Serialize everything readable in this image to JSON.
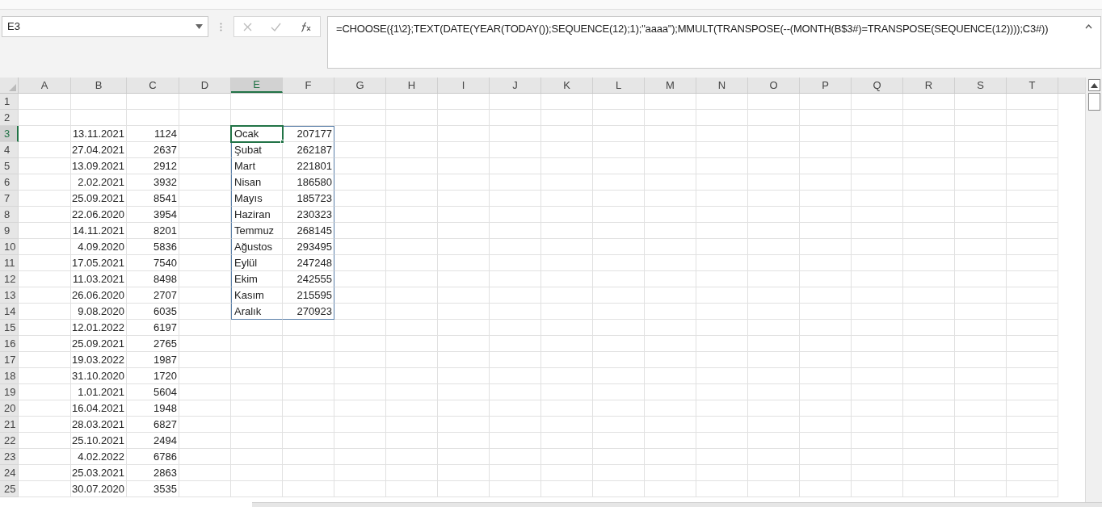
{
  "name_box": "E3",
  "formula": "=CHOOSE({1\\2};TEXT(DATE(YEAR(TODAY());SEQUENCE(12);1);\"aaaa\");MMULT(TRANSPOSE(--(MONTH(B$3#)=TRANSPOSE(SEQUENCE(12))));C3#))",
  "columns": [
    {
      "label": "A",
      "selected": false
    },
    {
      "label": "B",
      "selected": false
    },
    {
      "label": "C",
      "selected": false
    },
    {
      "label": "D",
      "selected": false
    },
    {
      "label": "E",
      "selected": true
    },
    {
      "label": "F",
      "selected": false
    },
    {
      "label": "G",
      "selected": false
    },
    {
      "label": "H",
      "selected": false
    },
    {
      "label": "I",
      "selected": false
    },
    {
      "label": "J",
      "selected": false
    },
    {
      "label": "K",
      "selected": false
    },
    {
      "label": "L",
      "selected": false
    },
    {
      "label": "M",
      "selected": false
    },
    {
      "label": "N",
      "selected": false
    },
    {
      "label": "O",
      "selected": false
    },
    {
      "label": "P",
      "selected": false
    },
    {
      "label": "Q",
      "selected": false
    },
    {
      "label": "R",
      "selected": false
    },
    {
      "label": "S",
      "selected": false
    },
    {
      "label": "T",
      "selected": false
    }
  ],
  "rows": [
    {
      "number": "1",
      "selected": false
    },
    {
      "number": "2",
      "selected": false
    },
    {
      "number": "3",
      "selected": true,
      "b": {
        "text": "13.11.2021",
        "selected": false
      },
      "c": {
        "text": "1124",
        "selected": false
      },
      "e": {
        "text": "Ocak",
        "selected": true,
        "spill": true
      },
      "f": {
        "text": "207177",
        "selected": false,
        "spill": true
      }
    },
    {
      "number": "4",
      "selected": false,
      "b": {
        "text": "27.04.2021",
        "selected": false
      },
      "c": {
        "text": "2637",
        "selected": false
      },
      "e": {
        "text": "Şubat",
        "selected": false,
        "spill": true
      },
      "f": {
        "text": "262187",
        "selected": false,
        "spill": true
      }
    },
    {
      "number": "5",
      "selected": false,
      "b": {
        "text": "13.09.2021",
        "selected": false
      },
      "c": {
        "text": "2912",
        "selected": false
      },
      "e": {
        "text": "Mart",
        "selected": false,
        "spill": true
      },
      "f": {
        "text": "221801",
        "selected": false,
        "spill": true
      }
    },
    {
      "number": "6",
      "selected": false,
      "b": {
        "text": "2.02.2021",
        "selected": false
      },
      "c": {
        "text": "3932",
        "selected": false
      },
      "e": {
        "text": "Nisan",
        "selected": false,
        "spill": true
      },
      "f": {
        "text": "186580",
        "selected": false,
        "spill": true
      }
    },
    {
      "number": "7",
      "selected": false,
      "b": {
        "text": "25.09.2021",
        "selected": false
      },
      "c": {
        "text": "8541",
        "selected": false
      },
      "e": {
        "text": "Mayıs",
        "selected": false,
        "spill": true
      },
      "f": {
        "text": "185723",
        "selected": false,
        "spill": true
      }
    },
    {
      "number": "8",
      "selected": false,
      "b": {
        "text": "22.06.2020",
        "selected": false
      },
      "c": {
        "text": "3954",
        "selected": false
      },
      "e": {
        "text": "Haziran",
        "selected": false,
        "spill": true
      },
      "f": {
        "text": "230323",
        "selected": false,
        "spill": true
      }
    },
    {
      "number": "9",
      "selected": false,
      "b": {
        "text": "14.11.2021",
        "selected": false
      },
      "c": {
        "text": "8201",
        "selected": false
      },
      "e": {
        "text": "Temmuz",
        "selected": false,
        "spill": true
      },
      "f": {
        "text": "268145",
        "selected": false,
        "spill": true
      }
    },
    {
      "number": "10",
      "selected": false,
      "b": {
        "text": "4.09.2020",
        "selected": false
      },
      "c": {
        "text": "5836",
        "selected": false
      },
      "e": {
        "text": "Ağustos",
        "selected": false,
        "spill": true
      },
      "f": {
        "text": "293495",
        "selected": false,
        "spill": true
      }
    },
    {
      "number": "11",
      "selected": false,
      "b": {
        "text": "17.05.2021",
        "selected": false
      },
      "c": {
        "text": "7540",
        "selected": false
      },
      "e": {
        "text": "Eylül",
        "selected": false,
        "spill": true
      },
      "f": {
        "text": "247248",
        "selected": false,
        "spill": true
      }
    },
    {
      "number": "12",
      "selected": false,
      "b": {
        "text": "11.03.2021",
        "selected": false
      },
      "c": {
        "text": "8498",
        "selected": false
      },
      "e": {
        "text": "Ekim",
        "selected": false,
        "spill": true
      },
      "f": {
        "text": "242555",
        "selected": false,
        "spill": true
      }
    },
    {
      "number": "13",
      "selected": false,
      "b": {
        "text": "26.06.2020",
        "selected": false
      },
      "c": {
        "text": "2707",
        "selected": false
      },
      "e": {
        "text": "Kasım",
        "selected": false,
        "spill": true
      },
      "f": {
        "text": "215595",
        "selected": false,
        "spill": true
      }
    },
    {
      "number": "14",
      "selected": false,
      "b": {
        "text": "9.08.2020",
        "selected": false
      },
      "c": {
        "text": "6035",
        "selected": false
      },
      "e": {
        "text": "Aralık",
        "selected": false,
        "spill": true
      },
      "f": {
        "text": "270923",
        "selected": false,
        "spill": true
      }
    },
    {
      "number": "15",
      "selected": false,
      "b": {
        "text": "12.01.2022",
        "selected": false
      },
      "c": {
        "text": "6197",
        "selected": false
      }
    },
    {
      "number": "16",
      "selected": false,
      "b": {
        "text": "25.09.2021",
        "selected": false
      },
      "c": {
        "text": "2765",
        "selected": false
      }
    },
    {
      "number": "17",
      "selected": false,
      "b": {
        "text": "19.03.2022",
        "selected": false
      },
      "c": {
        "text": "1987",
        "selected": false
      }
    },
    {
      "number": "18",
      "selected": false,
      "b": {
        "text": "31.10.2020",
        "selected": false
      },
      "c": {
        "text": "1720",
        "selected": false
      }
    },
    {
      "number": "19",
      "selected": false,
      "b": {
        "text": "1.01.2021",
        "selected": false
      },
      "c": {
        "text": "5604",
        "selected": false
      }
    },
    {
      "number": "20",
      "selected": false,
      "b": {
        "text": "16.04.2021",
        "selected": false
      },
      "c": {
        "text": "1948",
        "selected": false
      }
    },
    {
      "number": "21",
      "selected": false,
      "b": {
        "text": "28.03.2021",
        "selected": false
      },
      "c": {
        "text": "6827",
        "selected": false
      }
    },
    {
      "number": "22",
      "selected": false,
      "b": {
        "text": "25.10.2021",
        "selected": false
      },
      "c": {
        "text": "2494",
        "selected": false
      }
    },
    {
      "number": "23",
      "selected": false,
      "b": {
        "text": "4.02.2022",
        "selected": false
      },
      "c": {
        "text": "6786",
        "selected": false
      }
    },
    {
      "number": "24",
      "selected": false,
      "b": {
        "text": "25.03.2021",
        "selected": false
      },
      "c": {
        "text": "2863",
        "selected": false
      }
    },
    {
      "number": "25",
      "selected": false,
      "b": {
        "text": "30.07.2020",
        "selected": false
      },
      "c": {
        "text": "3535",
        "selected": false
      }
    }
  ]
}
